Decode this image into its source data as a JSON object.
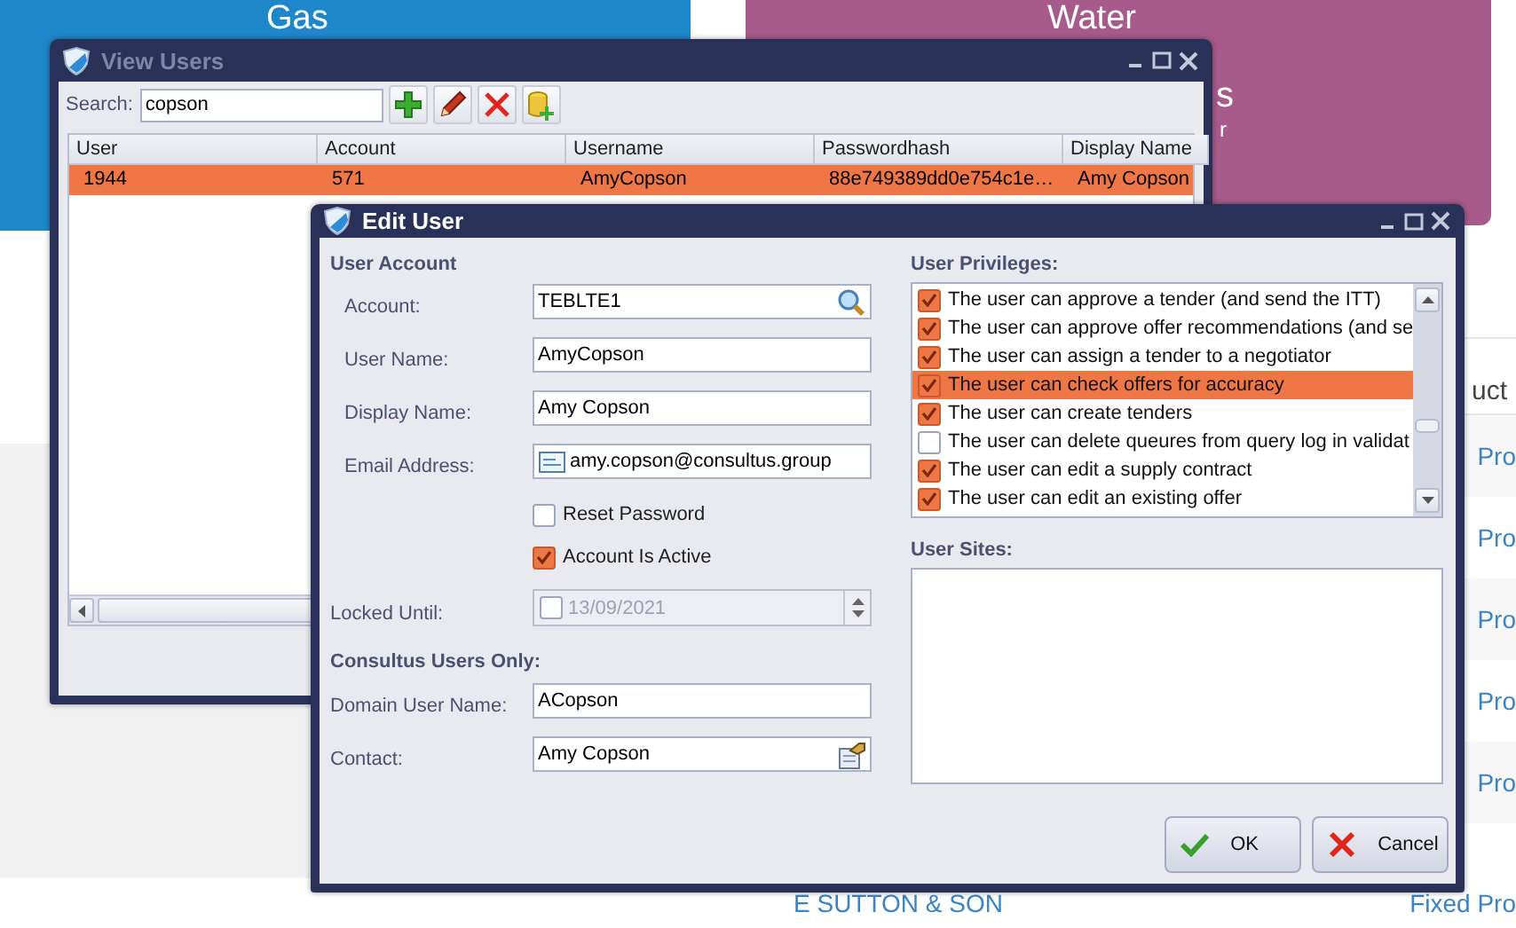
{
  "background": {
    "tiles": [
      {
        "title": "Gas",
        "color": "#1e87c9"
      },
      {
        "title": "Water",
        "subtitle": "s",
        "caption": "r",
        "color": "#a75b8b"
      }
    ],
    "table_heading": "uct",
    "rows": [
      {
        "link": "Pro"
      },
      {
        "link": "Pro"
      },
      {
        "link": "Pro"
      },
      {
        "link": "Pro"
      },
      {
        "link": "Pro"
      }
    ],
    "last_row": {
      "column_1": "E SUTTON & SON",
      "column_2": "Fixed Pro"
    }
  },
  "view_users": {
    "title": "View Users",
    "active": false,
    "search": {
      "label": "Search:",
      "value": "copson"
    },
    "table": {
      "columns": [
        "User",
        "Account",
        "Username",
        "Passwordhash",
        "Display Name"
      ],
      "rows": [
        {
          "cells": [
            "1944",
            "571",
            "AmyCopson",
            "88e749389dd0e754c1e…",
            "Amy Copson"
          ],
          "selected": true
        }
      ]
    }
  },
  "edit_user": {
    "title": "Edit User",
    "active": true,
    "account_section": {
      "heading": "User Account",
      "fields": [
        {
          "label": "Account:",
          "value": "TEBLTE1",
          "kind": "lookup"
        },
        {
          "label": "User Name:",
          "value": "AmyCopson",
          "kind": "text"
        },
        {
          "label": "Display Name:",
          "value": "Amy Copson",
          "kind": "text"
        },
        {
          "label": "Email Address:",
          "value": "amy.copson@consultus.group",
          "kind": "email"
        }
      ],
      "checkboxes": [
        {
          "label": "Reset Password",
          "checked": false
        },
        {
          "label": "Account Is Active",
          "checked": true
        }
      ],
      "locked_until": {
        "label": "Locked Until:",
        "value": "13/09/2021",
        "checked": false
      }
    },
    "consultus_section": {
      "heading": "Consultus Users Only:",
      "fields": [
        {
          "label": "Domain User Name:",
          "value": "ACopson",
          "kind": "text"
        },
        {
          "label": "Contact:",
          "value": "Amy Copson",
          "kind": "contact"
        }
      ]
    },
    "privileges": {
      "heading": "User Privileges:",
      "items": [
        {
          "label": "The user can approve a tender (and send the ITT)",
          "checked": true,
          "selected": false
        },
        {
          "label": "The user can approve offer recommendations (and se",
          "checked": true,
          "selected": false
        },
        {
          "label": "The user can assign a tender to a negotiator",
          "checked": true,
          "selected": false
        },
        {
          "label": "The user can check offers for accuracy",
          "checked": true,
          "selected": true
        },
        {
          "label": "The user can create tenders",
          "checked": true,
          "selected": false
        },
        {
          "label": "The user can delete queures from query log in validat",
          "checked": false,
          "selected": false
        },
        {
          "label": "The user can edit a supply contract",
          "checked": true,
          "selected": false
        },
        {
          "label": "The user can edit an existing offer",
          "checked": true,
          "selected": false
        }
      ]
    },
    "sites": {
      "heading": "User Sites:"
    },
    "buttons": [
      {
        "label": "OK",
        "kind": "ok"
      },
      {
        "label": "Cancel",
        "kind": "cancel"
      }
    ]
  }
}
